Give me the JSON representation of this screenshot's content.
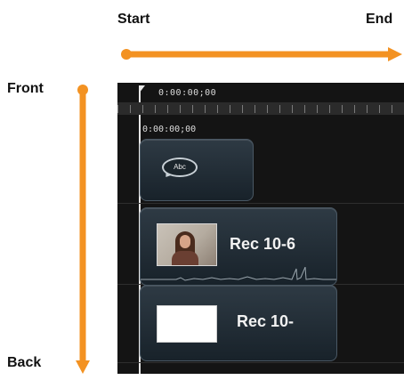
{
  "axis_labels": {
    "start": "Start",
    "end": "End",
    "front": "Front",
    "back": "Back"
  },
  "colors": {
    "arrow": "#f39222",
    "timeline_background": "#141414",
    "clip_fill": "#1f2b33"
  },
  "timeline": {
    "playhead_time": "0:00:00;00",
    "ruler_time": "0:00:00;00",
    "tracks": [
      {
        "type": "title",
        "icon": "speech-bubble-icon",
        "icon_text": "Abc"
      },
      {
        "type": "video",
        "label": "Rec 10-6",
        "thumbnail": "person-recording"
      },
      {
        "type": "video",
        "label": "Rec 10-",
        "thumbnail": "blank-white"
      }
    ]
  }
}
